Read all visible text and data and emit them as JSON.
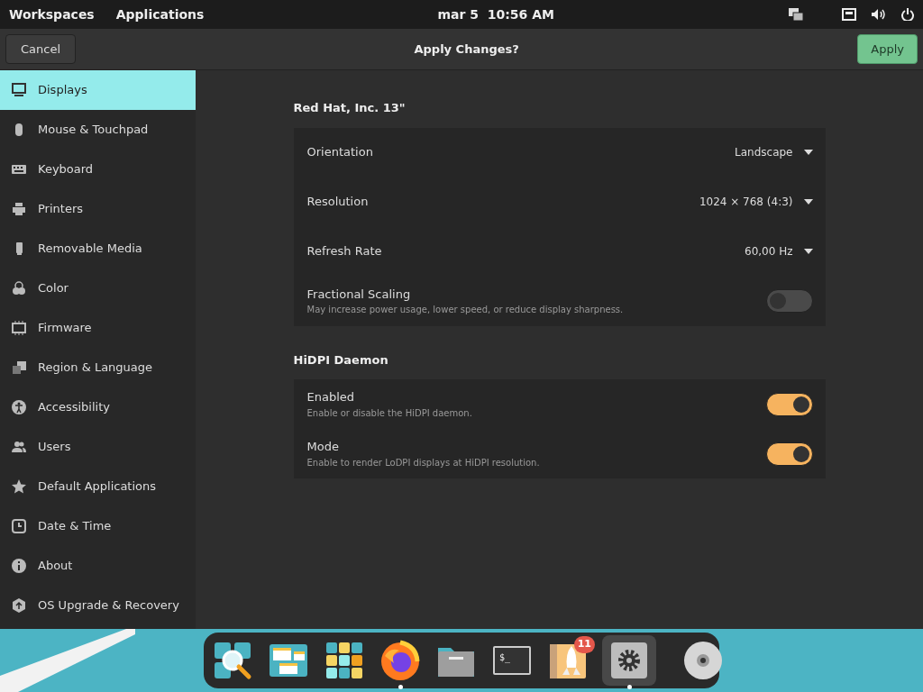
{
  "top_bar": {
    "menus": [
      "Workspaces",
      "Applications"
    ],
    "clock": "mar 5  10:56 AM"
  },
  "header": {
    "cancel": "Cancel",
    "title": "Apply Changes?",
    "apply": "Apply"
  },
  "sidebar": {
    "items": [
      {
        "label": "Displays",
        "selected": true
      },
      {
        "label": "Mouse & Touchpad",
        "selected": false
      },
      {
        "label": "Keyboard",
        "selected": false
      },
      {
        "label": "Printers",
        "selected": false
      },
      {
        "label": "Removable Media",
        "selected": false
      },
      {
        "label": "Color",
        "selected": false
      },
      {
        "label": "Firmware",
        "selected": false
      },
      {
        "label": "Region & Language",
        "selected": false
      },
      {
        "label": "Accessibility",
        "selected": false
      },
      {
        "label": "Users",
        "selected": false
      },
      {
        "label": "Default Applications",
        "selected": false
      },
      {
        "label": "Date & Time",
        "selected": false
      },
      {
        "label": "About",
        "selected": false
      },
      {
        "label": "OS Upgrade & Recovery",
        "selected": false
      }
    ]
  },
  "sections": [
    {
      "title": "Red Hat, Inc. 13\"",
      "rows": [
        {
          "kind": "dropdown",
          "label": "Orientation",
          "value": "Landscape"
        },
        {
          "kind": "dropdown",
          "label": "Resolution",
          "value": "1024 × 768 (4:3)"
        },
        {
          "kind": "dropdown",
          "label": "Refresh Rate",
          "value": "60,00 Hz"
        },
        {
          "kind": "switch",
          "label": "Fractional Scaling",
          "description": "May increase power usage, lower speed, or reduce display sharpness.",
          "on": false
        }
      ]
    },
    {
      "title": "HiDPI Daemon",
      "rows": [
        {
          "kind": "switch",
          "label": "Enabled",
          "description": "Enable or disable the HiDPI daemon.",
          "on": true
        },
        {
          "kind": "switch",
          "label": "Mode",
          "description": "Enable to render LoDPI displays at HiDPI resolution.",
          "on": true
        }
      ]
    }
  ],
  "dock": {
    "items": [
      {
        "kind": "search",
        "running": false,
        "active": false
      },
      {
        "kind": "windows",
        "running": false,
        "active": false
      },
      {
        "kind": "grid",
        "running": false,
        "active": false
      },
      {
        "kind": "browser",
        "running": true,
        "active": false
      },
      {
        "kind": "folder",
        "running": false,
        "active": false
      },
      {
        "kind": "terminal",
        "prompt": "$_",
        "running": false,
        "active": false
      },
      {
        "kind": "launcher",
        "badge": "11",
        "running": false,
        "active": false
      },
      {
        "kind": "settings",
        "running": true,
        "active": true
      },
      {
        "kind": "separator"
      },
      {
        "kind": "disc",
        "running": false,
        "active": false
      }
    ]
  }
}
